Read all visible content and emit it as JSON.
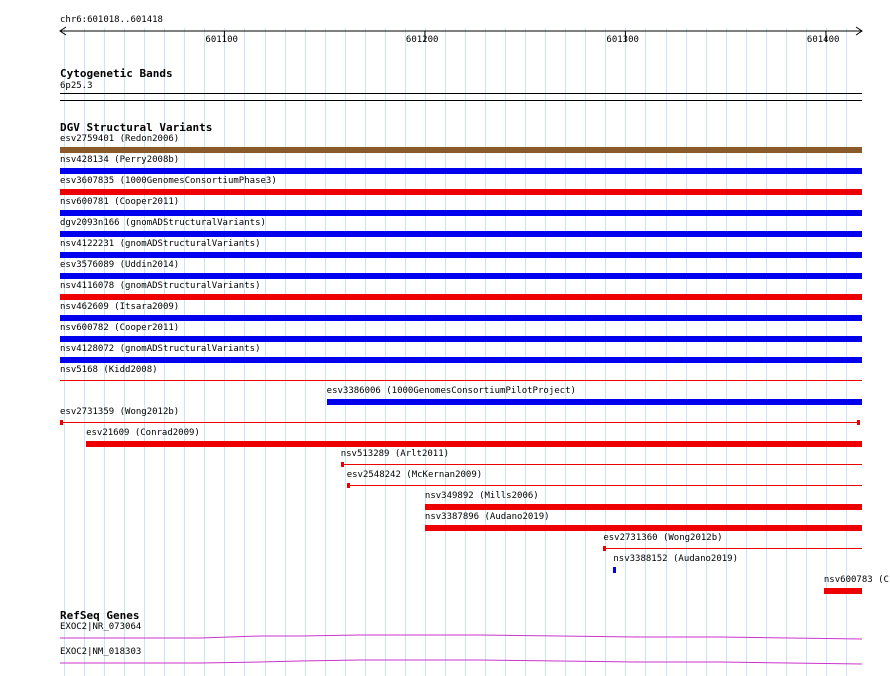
{
  "ruler": {
    "location": "chr6:601018..601418",
    "start": 601018,
    "end": 601418,
    "ticks": [
      {
        "pos": 601100,
        "label": "601100"
      },
      {
        "pos": 601200,
        "label": "601200"
      },
      {
        "pos": 601300,
        "label": "601300"
      },
      {
        "pos": 601400,
        "label": "601400"
      }
    ]
  },
  "colors": {
    "gain": "#0000ee",
    "loss": "#ee0000",
    "complex": "#8b5a2b",
    "gene": "#cc33cc",
    "grid": "#c9e4f2"
  },
  "tracks": {
    "cytoband": {
      "title": "Cytogenetic Bands",
      "band": "6p25.3"
    },
    "dgv": {
      "title": "DGV Structural Variants",
      "features": [
        {
          "label": "esv2759401 (Redon2006)",
          "type": "complex",
          "start": 600000,
          "end": 602000
        },
        {
          "label": "nsv428134 (Perry2008b)",
          "type": "gain",
          "start": 600000,
          "end": 602000
        },
        {
          "label": "esv3607835 (1000GenomesConsortiumPhase3)",
          "type": "loss",
          "start": 600000,
          "end": 602000
        },
        {
          "label": "nsv600781 (Cooper2011)",
          "type": "gain",
          "start": 600000,
          "end": 602000
        },
        {
          "label": "dgv2093n166 (gnomADStructuralVariants)",
          "type": "gain",
          "start": 600000,
          "end": 602000
        },
        {
          "label": "nsv4122231 (gnomADStructuralVariants)",
          "type": "gain",
          "start": 600000,
          "end": 602000
        },
        {
          "label": "esv3576089 (Uddin2014)",
          "type": "gain",
          "start": 600000,
          "end": 602000
        },
        {
          "label": "nsv4116078 (gnomADStructuralVariants)",
          "type": "loss",
          "start": 600000,
          "end": 602000
        },
        {
          "label": "nsv462609 (Itsara2009)",
          "type": "gain",
          "start": 600000,
          "end": 602000
        },
        {
          "label": "nsv600782 (Cooper2011)",
          "type": "gain",
          "start": 600000,
          "end": 602000
        },
        {
          "label": "nsv4128072 (gnomADStructuralVariants)",
          "type": "gain",
          "start": 600000,
          "end": 602000
        },
        {
          "label": "nsv5168 (Kidd2008)",
          "type": "loss-thin",
          "start": 600000,
          "end": 602000
        },
        {
          "label": "esv3386006 (1000GenomesConsortiumPilotProject)",
          "type": "gain",
          "start": 601151,
          "end": 602000
        },
        {
          "label": "esv2731359 (Wong2012b)",
          "type": "loss-flank",
          "start": 601018,
          "end": 601417
        },
        {
          "label": "esv21609 (Conrad2009)",
          "type": "loss",
          "start": 601031,
          "end": 602000
        },
        {
          "label": "nsv513289 (Arlt2011)",
          "type": "loss-flank",
          "start": 601158,
          "end": 602000
        },
        {
          "label": "esv2548242 (McKernan2009)",
          "type": "loss-flank",
          "start": 601161,
          "end": 602000
        },
        {
          "label": "nsv349892 (Mills2006)",
          "type": "loss",
          "start": 601200,
          "end": 602000
        },
        {
          "label": "nsv3387896 (Audano2019)",
          "type": "loss",
          "start": 601200,
          "end": 602000
        },
        {
          "label": "esv2731360 (Wong2012b)",
          "type": "loss-flank",
          "start": 601289,
          "end": 602000
        },
        {
          "label": "nsv3388152 (Audano2019)",
          "type": "gain",
          "start": 601294,
          "end": 601295
        },
        {
          "label": "nsv600783 (C",
          "type": "loss",
          "start": 601399,
          "end": 602000
        }
      ]
    },
    "refseq": {
      "title": "RefSeq Genes",
      "genes": [
        {
          "label": "EXOC2|NR_073064"
        },
        {
          "label": "EXOC2|NM_018303"
        }
      ]
    }
  }
}
